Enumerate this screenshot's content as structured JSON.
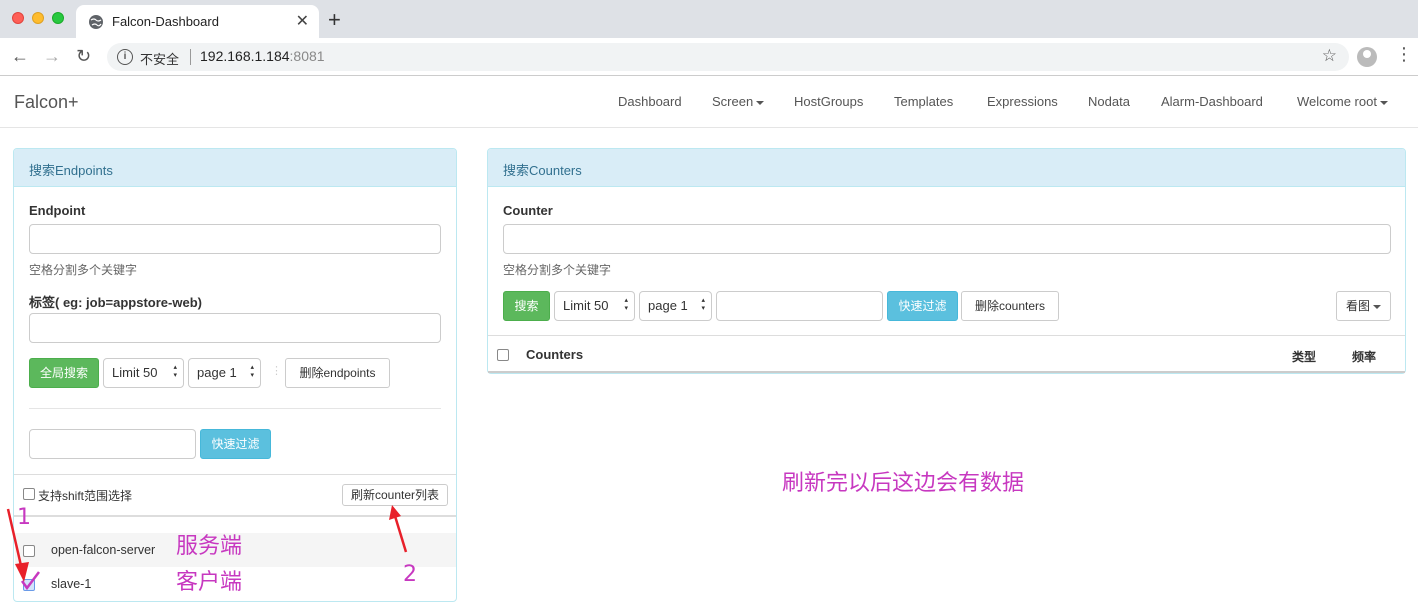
{
  "browser": {
    "tab_title": "Falcon-Dashboard",
    "tab_close": "✕",
    "new_tab": "+",
    "security_label": "不安全",
    "url_host": "192.168.1.184",
    "url_port": ":8081"
  },
  "navbar": {
    "brand": "Falcon+",
    "items": [
      "Dashboard",
      "Screen",
      "HostGroups",
      "Templates",
      "Expressions",
      "Nodata",
      "Alarm-Dashboard",
      "Welcome root"
    ]
  },
  "endpoints_panel": {
    "title": "搜索Endpoints",
    "endpoint_label": "Endpoint",
    "endpoint_value": "",
    "endpoint_help": "空格分割多个关键字",
    "tag_label": "标签( eg: job=appstore-web)",
    "tag_value": "",
    "search_all_button": "全局搜索",
    "limit_select": "Limit 50",
    "page_select": "page 1",
    "delete_button": "删除endpoints",
    "filter_value": "",
    "quick_filter_button": "快速过滤",
    "shift_select_label": "支持shift范围选择",
    "refresh_counter_button": "刷新counter列表",
    "endpoints": [
      {
        "name": "open-falcon-server",
        "checked": false
      },
      {
        "name": "slave-1",
        "checked": true
      }
    ]
  },
  "counters_panel": {
    "title": "搜索Counters",
    "counter_label": "Counter",
    "counter_value": "",
    "counter_help": "空格分割多个关键字",
    "search_button": "搜索",
    "limit_select": "Limit 50",
    "page_select": "page 1",
    "filter_value": "",
    "quick_filter_button": "快速过滤",
    "delete_button": "删除counters",
    "view_chart_button": "看图",
    "table_headers": {
      "counters": "Counters",
      "type": "类型",
      "freq": "频率"
    }
  },
  "annotations": {
    "marker_1": "1",
    "marker_2": "2",
    "server_note": "服务端",
    "client_note": "客户端",
    "data_note": "刷新完以后这边会有数据",
    "color": "#c738c0",
    "arrow_color": "#e8202a"
  }
}
